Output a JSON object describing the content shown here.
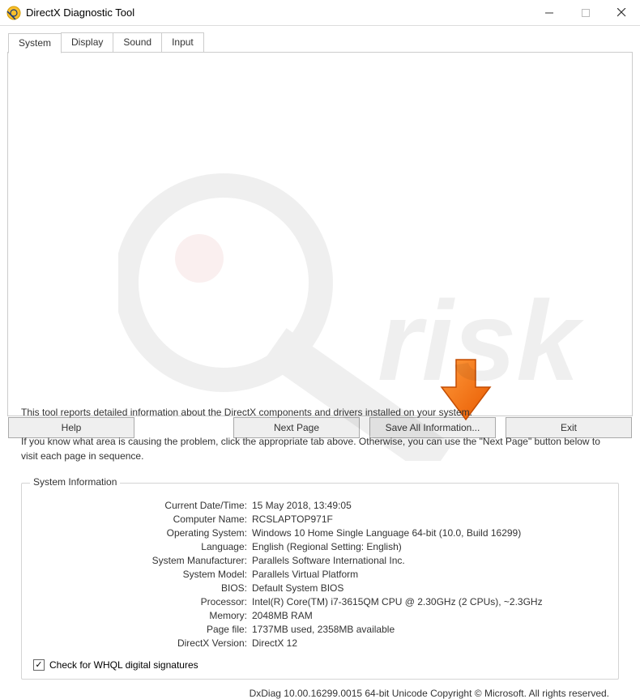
{
  "window": {
    "title": "DirectX Diagnostic Tool"
  },
  "tabs": {
    "system": "System",
    "display": "Display",
    "sound": "Sound",
    "input": "Input"
  },
  "intro": {
    "line1": "This tool reports detailed information about the DirectX components and drivers installed on your system.",
    "line2": "If you know what area is causing the problem, click the appropriate tab above.  Otherwise, you can use the \"Next Page\" button below to visit each page in sequence."
  },
  "sysinfo": {
    "legend": "System Information",
    "fields": [
      {
        "label": "Current Date/Time:",
        "value": "15 May 2018, 13:49:05"
      },
      {
        "label": "Computer Name:",
        "value": "RCSLAPTOP971F"
      },
      {
        "label": "Operating System:",
        "value": "Windows 10 Home Single Language 64-bit (10.0, Build 16299)"
      },
      {
        "label": "Language:",
        "value": "English (Regional Setting: English)"
      },
      {
        "label": "System Manufacturer:",
        "value": "Parallels Software International Inc."
      },
      {
        "label": "System Model:",
        "value": "Parallels Virtual Platform"
      },
      {
        "label": "BIOS:",
        "value": "Default System BIOS"
      },
      {
        "label": "Processor:",
        "value": "Intel(R) Core(TM) i7-3615QM CPU @ 2.30GHz (2 CPUs), ~2.3GHz"
      },
      {
        "label": "Memory:",
        "value": "2048MB RAM"
      },
      {
        "label": "Page file:",
        "value": "1737MB used, 2358MB available"
      },
      {
        "label": "DirectX Version:",
        "value": "DirectX 12"
      }
    ],
    "whql_label": "Check for WHQL digital signatures",
    "whql_checked": true
  },
  "footer": "DxDiag 10.00.16299.0015 64-bit Unicode Copyright © Microsoft. All rights reserved.",
  "buttons": {
    "help": "Help",
    "next": "Next Page",
    "save": "Save All Information...",
    "exit": "Exit"
  }
}
